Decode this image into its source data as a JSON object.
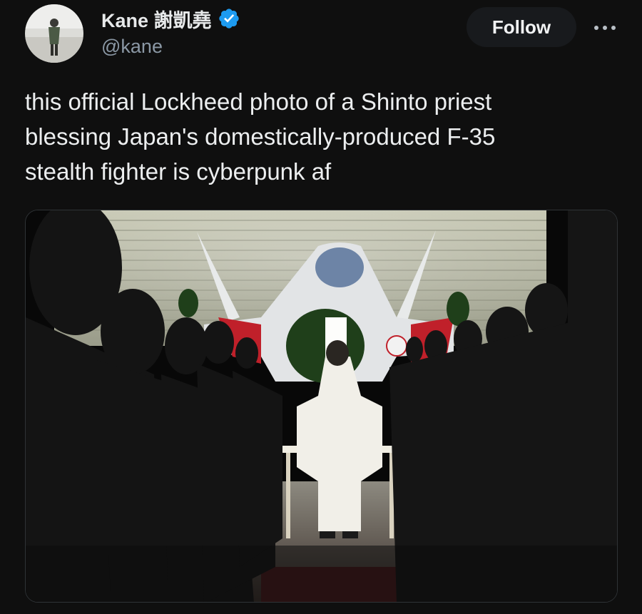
{
  "tweet": {
    "author": {
      "display_name": "Kane 謝凱堯",
      "handle": "@kane",
      "verified": true,
      "verified_color": "#1d9bf0",
      "avatar_icon": "avatar-photo-icon"
    },
    "follow_label": "Follow",
    "more_icon": "more-dots-icon",
    "text_lines": [
      "this official Lockheed photo of a Shinto priest",
      "blessing Japan's domestically-produced F-35",
      "stealth fighter is cyberpunk af"
    ],
    "media": {
      "kind": "photo",
      "icon": "photo-f35-shinto-blessing"
    }
  },
  "colors": {
    "background": "#0f0f0f",
    "text": "#e7e9ea",
    "secondary_text": "#8b98a5",
    "follow_button_bg": "#181a1d"
  }
}
